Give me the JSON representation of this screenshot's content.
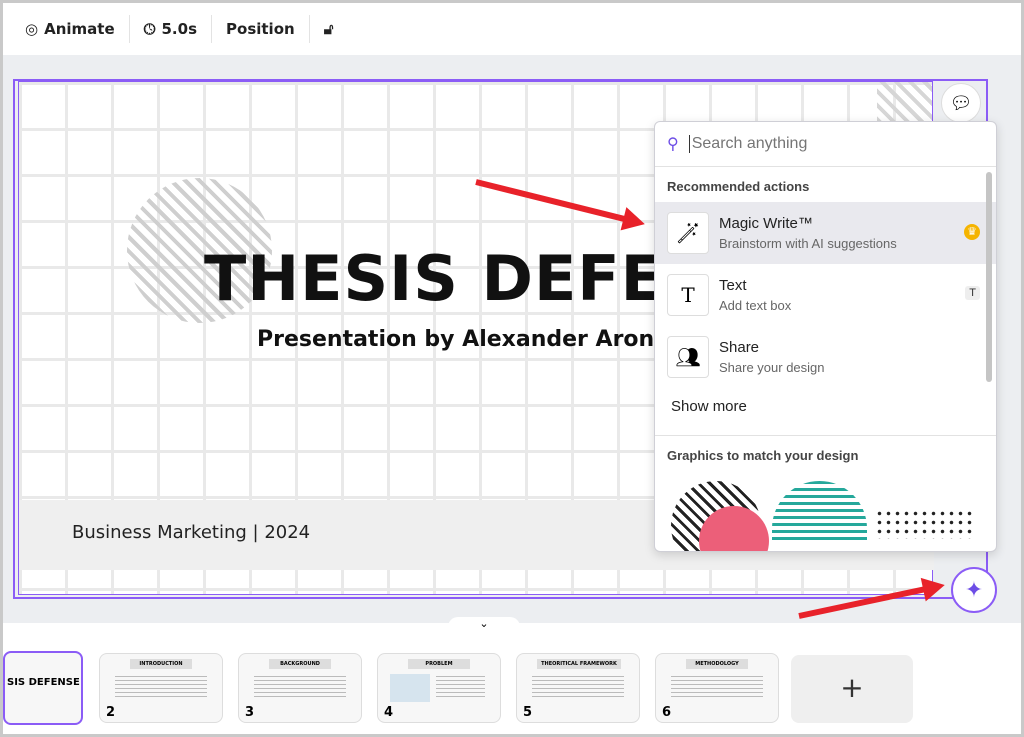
{
  "toolbar": {
    "animate": "Animate",
    "duration": "5.0s",
    "position": "Position"
  },
  "slide": {
    "title": "THESIS DEFENSE",
    "subtitle": "Presentation by Alexander Aronov",
    "footer": "Business Marketing | 2024"
  },
  "panel": {
    "search_placeholder": "Search anything",
    "recommended": "Recommended actions",
    "items": [
      {
        "label": "Magic Write™",
        "desc": "Brainstorm with AI suggestions",
        "badge": "crown-icon"
      },
      {
        "label": "Text",
        "desc": "Add text box",
        "badge": "T"
      },
      {
        "label": "Share",
        "desc": "Share your design"
      }
    ],
    "show_more": "Show more",
    "graphics": "Graphics to match your design"
  },
  "filmstrip": {
    "first_title": "SIS DEFENSE",
    "pages": [
      {
        "n": "2",
        "h": "INTRODUCTION"
      },
      {
        "n": "3",
        "h": "BACKGROUND"
      },
      {
        "n": "4",
        "h": "PROBLEM"
      },
      {
        "n": "5",
        "h": "THEORITICAL FRAMEWORK"
      },
      {
        "n": "6",
        "h": "METHODOLOGY"
      }
    ],
    "add": "+"
  },
  "colors": {
    "accent": "#8b5cf6",
    "arrow": "#e8222a"
  }
}
